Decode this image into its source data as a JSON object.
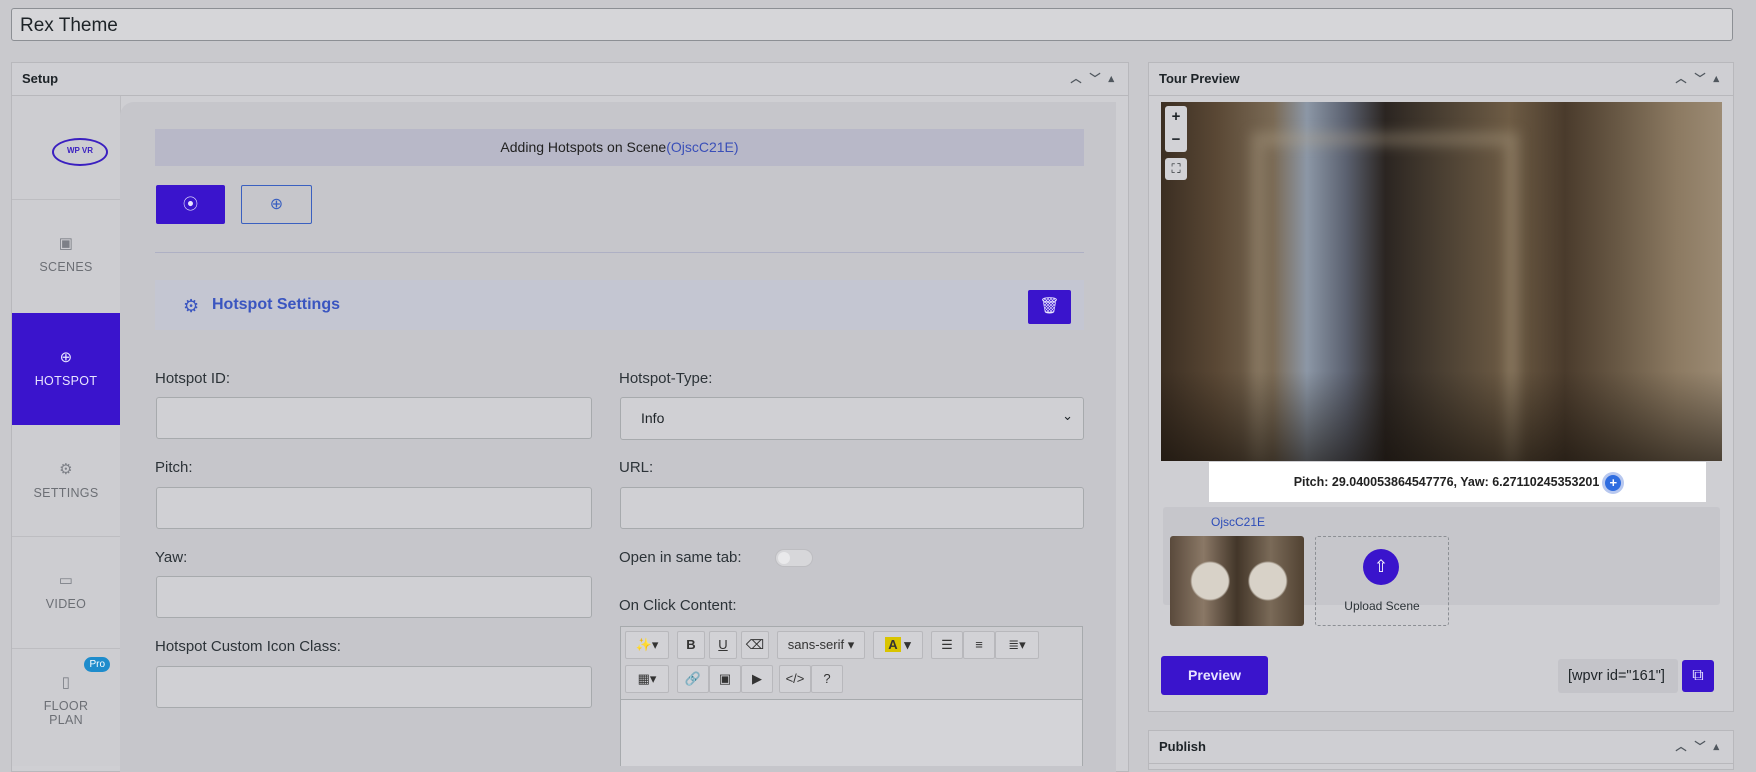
{
  "post_title": "Rex Theme",
  "setup_panel": {
    "title": "Setup",
    "controls": [
      "︿",
      "﹀",
      "▴"
    ]
  },
  "sidebar": {
    "logo_text": "WP VR",
    "items": [
      {
        "label": "SCENES",
        "icon": "image-icon",
        "glyph": "▣"
      },
      {
        "label": "HOTSPOT",
        "icon": "crosshair-icon",
        "glyph": "⊕"
      },
      {
        "label": "SETTINGS",
        "icon": "gear-icon",
        "glyph": "⚙"
      },
      {
        "label": "VIDEO",
        "icon": "video-camera-icon",
        "glyph": "▭"
      },
      {
        "label": "FLOOR PLAN",
        "icon": "map-icon",
        "glyph": "▯",
        "badge": "Pro"
      }
    ]
  },
  "hotspot": {
    "banner_prefix": "Adding Hotspots on Scene",
    "banner_scene": "(OjscC21E)",
    "tab_active_glyph": "⦿",
    "tab_add_glyph": "⊕",
    "settings_title": "Hotspot Settings",
    "delete_glyph": "🗑",
    "fields": {
      "id_label": "Hotspot ID:",
      "id_value": "",
      "type_label": "Hotspot-Type:",
      "type_value": "Info",
      "pitch_label": "Pitch:",
      "pitch_value": "",
      "url_label": "URL:",
      "url_value": "",
      "yaw_label": "Yaw:",
      "yaw_value": "",
      "same_tab_label": "Open in same tab:",
      "same_tab_on": false,
      "icon_class_label": "Hotspot Custom Icon Class:",
      "icon_class_value": "",
      "onclick_label": "On Click Content:"
    },
    "editor_toolbar": {
      "font_name": "sans-serif"
    }
  },
  "tour_preview": {
    "title": "Tour Preview",
    "zoom_in": "+",
    "zoom_out": "−",
    "fullscreen_glyph": "⛶",
    "coords_text": "Pitch: 29.040053864547776, Yaw: 6.27110245353201",
    "add_glyph": "+",
    "scene_name": "OjscC21E",
    "upload_label": "Upload Scene",
    "upload_glyph": "⇧",
    "preview_label": "Preview",
    "shortcode": "[wpvr id=\"161\"]",
    "copy_glyph": "⧉"
  },
  "publish_panel": {
    "title": "Publish"
  },
  "colors": {
    "accent": "#3a14cc",
    "link": "#3a55c0",
    "panel_bg": "#cfcfd3"
  }
}
